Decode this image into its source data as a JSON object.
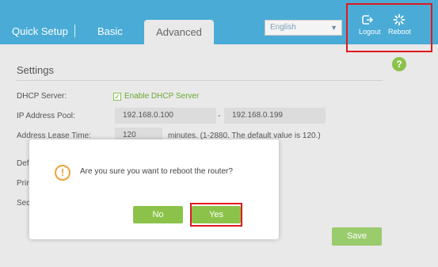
{
  "header": {
    "tabs": [
      {
        "label": "Quick Setup"
      },
      {
        "label": "Basic"
      },
      {
        "label": "Advanced",
        "active": true
      }
    ],
    "language": "English",
    "logout_label": "Logout",
    "reboot_label": "Reboot",
    "logout_icon": "logout-icon",
    "reboot_icon": "reboot-icon"
  },
  "settings": {
    "title": "Settings",
    "dhcp_server_label": "DHCP Server:",
    "enable_dhcp_label": "Enable DHCP Server",
    "enable_dhcp_checked": true,
    "ip_pool_label": "IP Address Pool:",
    "ip_pool_start": "192.168.0.100",
    "ip_pool_dash": "-",
    "ip_pool_end": "192.168.0.199",
    "lease_label": "Address Lease Time:",
    "lease_value": "120",
    "lease_note": "minutes. (1-2880. The default value is 120.)",
    "partial_labels": [
      "Def",
      "Prir",
      "Sec"
    ],
    "save_label": "Save"
  },
  "dialog": {
    "icon": "warning-icon",
    "message": "Are you sure you want to reboot the router?",
    "no_label": "No",
    "yes_label": "Yes"
  },
  "colors": {
    "header_bg": "#4aacd6",
    "accent_green": "#8bc34a",
    "highlight_red": "#e0191f",
    "warning_orange": "#f0a33a"
  }
}
